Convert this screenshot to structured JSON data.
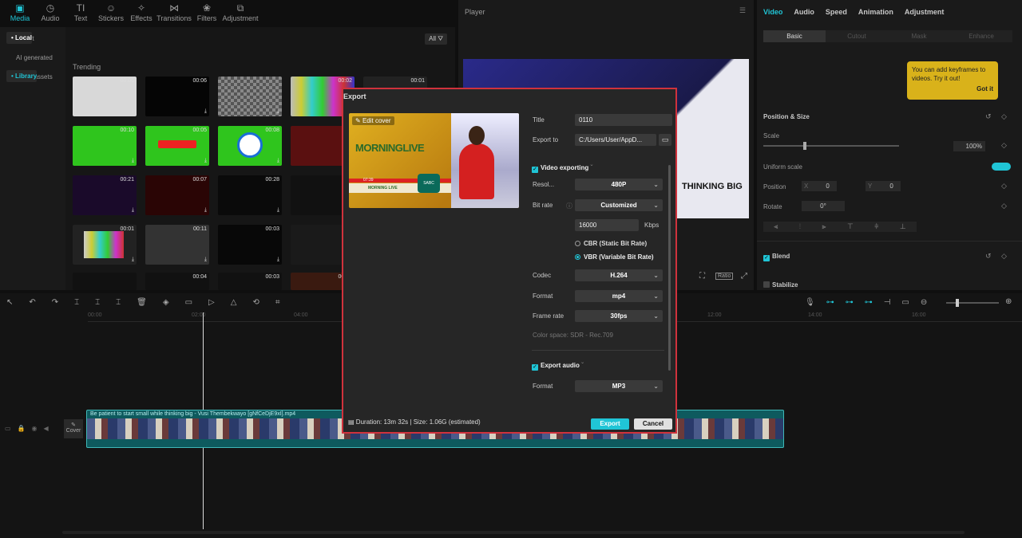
{
  "toolbar_tabs": [
    {
      "label": "Media",
      "icon": "media-icon"
    },
    {
      "label": "Audio",
      "icon": "audio-icon"
    },
    {
      "label": "Text",
      "icon": "text-icon"
    },
    {
      "label": "Stickers",
      "icon": "stickers-icon"
    },
    {
      "label": "Effects",
      "icon": "effects-icon"
    },
    {
      "label": "Transitions",
      "icon": "transitions-icon"
    },
    {
      "label": "Filters",
      "icon": "filters-icon"
    },
    {
      "label": "Adjustment",
      "icon": "adjustment-icon"
    }
  ],
  "left_nav": [
    "• Local",
    "Import",
    "AI generated",
    "• Library",
    "• Brand assets"
  ],
  "media": {
    "filter_label": "All",
    "section": "Trending",
    "durations": [
      "00:06",
      "00:06",
      "00:02",
      "00:01",
      "00:10",
      "00:05",
      "00:08",
      "00:21",
      "00:07",
      "00:28",
      "00:01",
      "00:11",
      "00:03",
      "00:04",
      "00:03",
      "00:02"
    ]
  },
  "player": {
    "title": "Player",
    "overlay_text": "THINKING BIG",
    "ratio_label": "Ratio"
  },
  "right_panel": {
    "tabs": [
      "Video",
      "Audio",
      "Speed",
      "Animation",
      "Adjustment"
    ],
    "subtabs": [
      "Basic",
      "Cutout",
      "Mask",
      "Enhance"
    ],
    "tooltip": "You can add keyframes to videos. Try it out!",
    "tooltip_action": "Got it",
    "position_size": "Position & Size",
    "scale_label": "Scale",
    "scale_value": "100%",
    "uniform_scale": "Uniform scale",
    "position_label": "Position",
    "pos_x_label": "X",
    "pos_x": "0",
    "pos_y_label": "Y",
    "pos_y": "0",
    "rotate_label": "Rotate",
    "rotate_value": "0°",
    "blend": "Blend",
    "stabilize": "Stabilize"
  },
  "timeline": {
    "ticks": [
      "00:00",
      "02:00",
      "04:00",
      "12:00",
      "14:00",
      "16:00"
    ],
    "clip_title": "Be patient to start small while thinking big - Vusi Thembekwayo [gNfCeDjE9xI].mp4",
    "cover_label": "Cover"
  },
  "export": {
    "title": "Export",
    "edit_cover": "Edit cover",
    "title_label": "Title",
    "title_value": "0110",
    "export_to_label": "Export to",
    "export_to_value": "C:/Users/User/AppD...",
    "video_exporting": "Video exporting",
    "resolution_label": "Resol...",
    "resolution_value": "480P",
    "bitrate_label": "Bit rate",
    "bitrate_mode": "Customized",
    "bitrate_value": "16000",
    "bitrate_unit": "Kbps",
    "cbr": "CBR (Static Bit Rate)",
    "vbr": "VBR (Variable Bit Rate)",
    "codec_label": "Codec",
    "codec_value": "H.264",
    "format_label": "Format",
    "format_value": "mp4",
    "framerate_label": "Frame rate",
    "framerate_value": "30fps",
    "color_space": "Color space: SDR - Rec.709",
    "export_audio": "Export audio",
    "audio_format_label": "Format",
    "audio_format_value": "MP3",
    "footer_info": "Duration: 13m 32s | Size: 1.06G (estimated)",
    "export_button": "Export",
    "cancel_button": "Cancel",
    "thumb_logo": "MORNINGLIVE",
    "thumb_time": "07:39",
    "thumb_sub": "MORNING LIVE",
    "thumb_brand": "SABC"
  },
  "colors": {
    "accent": "#20c5d6",
    "modal_border": "#d0323c"
  }
}
